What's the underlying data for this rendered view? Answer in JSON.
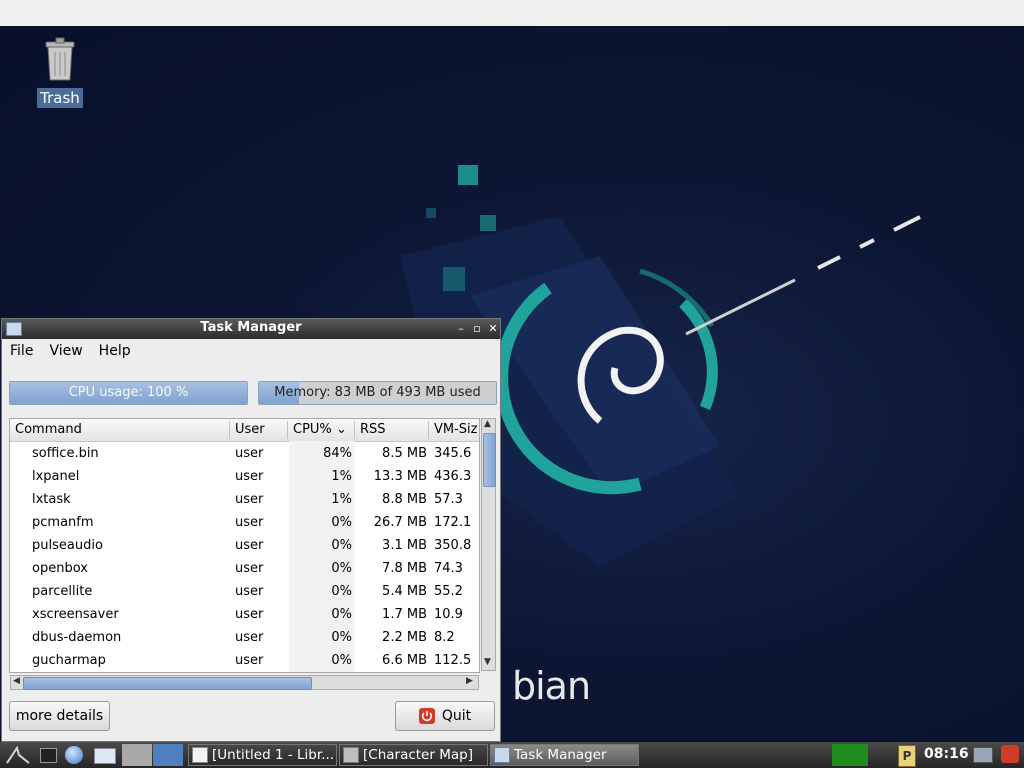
{
  "desktop": {
    "trash_label": "Trash",
    "brand_text": "bian"
  },
  "window": {
    "title": "Task Manager",
    "menu": [
      "File",
      "View",
      "Help"
    ],
    "cpu_label": "CPU usage: 100 %",
    "cpu_fraction": 1.0,
    "memory_label": "Memory: 83 MB of 493 MB used",
    "memory_fraction": 0.17,
    "columns": [
      "Command",
      "User",
      "CPU%",
      "RSS",
      "VM-Siz"
    ],
    "sort_indicator": "⌄",
    "rows": [
      {
        "command": "soffice.bin",
        "user": "user",
        "cpu": "84%",
        "rss": "8.5 MB",
        "vm": "345.6"
      },
      {
        "command": "lxpanel",
        "user": "user",
        "cpu": "1%",
        "rss": "13.3 MB",
        "vm": "436.3"
      },
      {
        "command": "lxtask",
        "user": "user",
        "cpu": "1%",
        "rss": "8.8 MB",
        "vm": "57.3"
      },
      {
        "command": "pcmanfm",
        "user": "user",
        "cpu": "0%",
        "rss": "26.7 MB",
        "vm": "172.1"
      },
      {
        "command": "pulseaudio",
        "user": "user",
        "cpu": "0%",
        "rss": "3.1 MB",
        "vm": "350.8"
      },
      {
        "command": "openbox",
        "user": "user",
        "cpu": "0%",
        "rss": "7.8 MB",
        "vm": "74.3"
      },
      {
        "command": "parcellite",
        "user": "user",
        "cpu": "0%",
        "rss": "5.4 MB",
        "vm": "55.2"
      },
      {
        "command": "xscreensaver",
        "user": "user",
        "cpu": "0%",
        "rss": "1.7 MB",
        "vm": "10.9"
      },
      {
        "command": "dbus-daemon",
        "user": "user",
        "cpu": "0%",
        "rss": "2.2 MB",
        "vm": "8.2"
      },
      {
        "command": "gucharmap",
        "user": "user",
        "cpu": "0%",
        "rss": "6.6 MB",
        "vm": "112.5"
      }
    ],
    "more_details_label": "more details",
    "quit_label": "Quit"
  },
  "taskbar": {
    "tasks": [
      {
        "label": "[Untitled 1 - Libr..."
      },
      {
        "label": "[Character Map]"
      },
      {
        "label": "Task Manager"
      }
    ],
    "clock": "08:16",
    "colors": {
      "accent": "#7fa2d0",
      "swirl": "#1fa39a",
      "cpu_monitor": "#1e8c1e",
      "power": "#d23a2a"
    }
  }
}
